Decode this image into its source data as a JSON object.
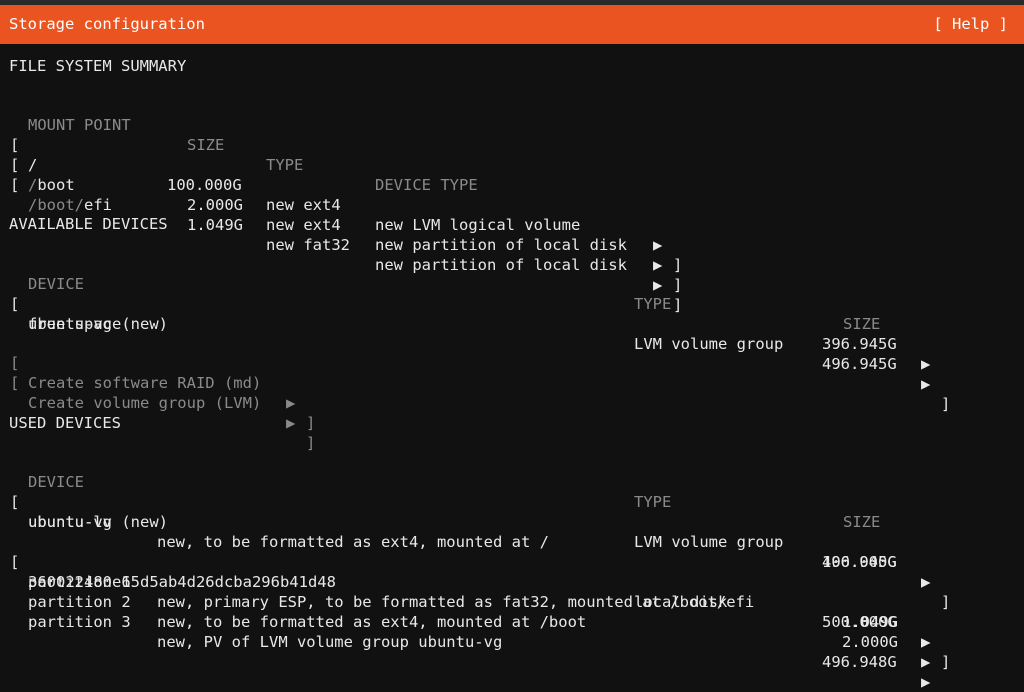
{
  "title": "Storage configuration",
  "help": "[ Help ]",
  "fs_summary": {
    "heading": "FILE SYSTEM SUMMARY",
    "headers": [
      "MOUNT POINT",
      "SIZE",
      "TYPE",
      "DEVICE TYPE"
    ],
    "rows": [
      {
        "mount_pre": "/",
        "mount_dim": "",
        "mount_post": "",
        "size": "100.000G",
        "type": "new ext4",
        "device_type": "new LVM logical volume"
      },
      {
        "mount_pre": "",
        "mount_dim": "/",
        "mount_post": "boot",
        "size": "2.000G",
        "type": "new ext4",
        "device_type": "new partition of local disk"
      },
      {
        "mount_pre": "",
        "mount_dim": "/boot/",
        "mount_post": "efi",
        "size": "1.049G",
        "type": "new fat32",
        "device_type": "new partition of local disk"
      }
    ]
  },
  "available": {
    "heading": "AVAILABLE DEVICES",
    "headers": [
      "DEVICE",
      "TYPE",
      "SIZE"
    ],
    "vg_name": "ubuntu-vg (new)",
    "vg_type": "LVM volume group",
    "vg_size": "496.945G",
    "free_label": "free space",
    "free_size": "396.945G",
    "raid_action": "Create software RAID (md)",
    "lvm_action": "Create volume group (LVM)"
  },
  "used": {
    "heading": "USED DEVICES",
    "headers": [
      "DEVICE",
      "TYPE",
      "SIZE"
    ],
    "vg_name": "ubuntu-vg (new)",
    "vg_type": "LVM volume group",
    "vg_size": "496.945G",
    "lv_name": "ubuntu-lv",
    "lv_desc": "new, to be formatted as ext4, mounted at /",
    "lv_size": "100.000G",
    "disk_name": "360022480e65d5ab4d26dcba296b41d48",
    "disk_type": "local disk",
    "disk_size": "500.000G",
    "partitions": [
      {
        "name": "partition 1",
        "desc": "new, primary ESP, to be formatted as fat32, mounted at /boot/efi",
        "size": "1.049G"
      },
      {
        "name": "partition 2",
        "desc": "new, to be formatted as ext4, mounted at /boot",
        "size": "2.000G"
      },
      {
        "name": "partition 3",
        "desc": "new, PV of LVM volume group ubuntu-vg",
        "size": "496.948G"
      }
    ]
  },
  "glyphs": {
    "arrow": "▶",
    "open": "[",
    "close": "]"
  }
}
